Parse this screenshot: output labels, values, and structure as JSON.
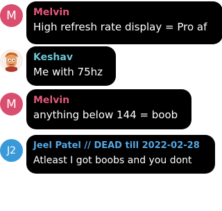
{
  "colors": {
    "melvin_name": "#e5597b",
    "keshav_name": "#6cc6d3",
    "jeel_name": "#56a8e6",
    "melvin_avatar": "#d94d6f",
    "jeel_avatar": "#3a9ad9",
    "bubble": "#000000"
  },
  "messages": [
    {
      "sender": "Melvin",
      "avatar_initial": "M",
      "text": "High refresh rate display = Pro af"
    },
    {
      "sender": "Keshav",
      "avatar_icon": "cartoon-avatar-icon",
      "text": "Me with 75hz"
    },
    {
      "sender": "Melvin",
      "avatar_initial": "M",
      "text": "anything below 144 = boob"
    },
    {
      "sender": "Jeel Patel // DEAD till 2022-02-28",
      "avatar_initial": "J2",
      "text": "Atleast I got boobs and you dont"
    }
  ]
}
